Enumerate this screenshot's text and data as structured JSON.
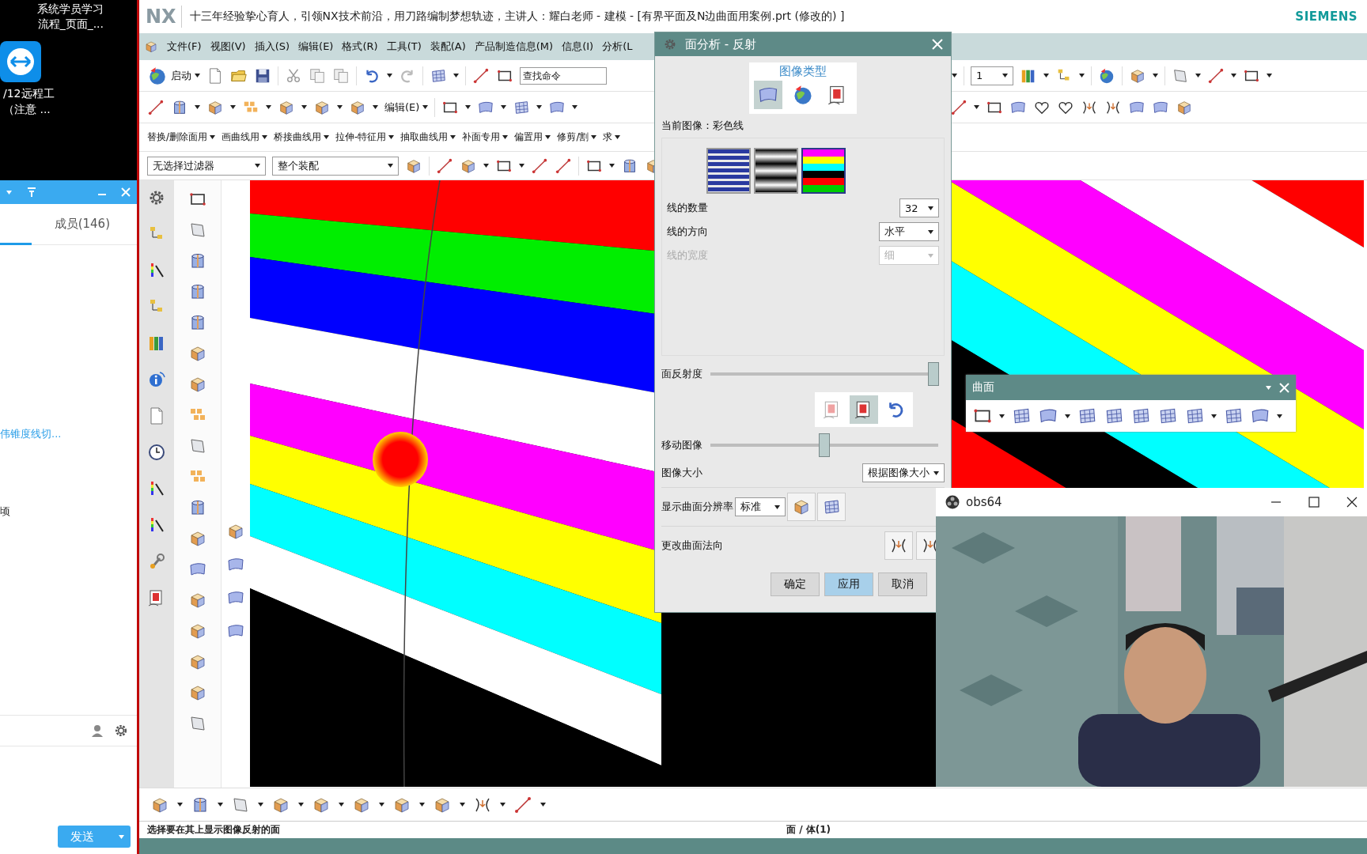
{
  "desktop": {
    "items": [
      {
        "lines": [
          "系统学员学习",
          "流程_页面_..."
        ]
      },
      {
        "lines": [
          "/12远程工",
          "（注意 ..."
        ]
      }
    ]
  },
  "chat": {
    "tab": "成员(146)",
    "link": "伟锥度线切...",
    "text": "顷",
    "send_button": "发送"
  },
  "nx": {
    "logo": "NX",
    "title": "十三年经验挚心育人，引领NX技术前沿，用刀路编制梦想轨迹，主讲人：耀白老师 - 建模 - [有界平面及N边曲面用案例.prt  (修改的) ]",
    "brand": "SIEMENS",
    "menu": [
      "文件(F)",
      "视图(V)",
      "插入(S)",
      "编辑(E)",
      "格式(R)",
      "工具(T)",
      "装配(A)",
      "产品制造信息(M)",
      "信息(I)",
      "分析(L"
    ],
    "start_button": "启动",
    "search": {
      "placeholder": "查找命令"
    },
    "edit_menu": "编辑(E)",
    "command_groups": [
      "替换/删除面用",
      "画曲线用",
      "桥接曲线用",
      "拉伸-特征用",
      "抽取曲线用",
      "补面专用",
      "偏置用",
      "修剪/割",
      "求"
    ],
    "filters": [
      "无选择过滤器",
      "整个装配"
    ],
    "layer_select": "1",
    "status": {
      "prompt": "选择要在其上显示图像反射的面",
      "selection": "面 / 体(1)"
    }
  },
  "dialog": {
    "title": "面分析 - 反射",
    "image_type": {
      "label": "图像类型",
      "options": [
        {
          "kind": "lines",
          "selected": true
        },
        {
          "kind": "scene",
          "selected": false
        },
        {
          "kind": "user",
          "selected": false
        }
      ]
    },
    "current_image": "当前图像：彩色线",
    "line_images": [
      {
        "kind": "blue",
        "selected": false
      },
      {
        "kind": "gray",
        "selected": false
      },
      {
        "kind": "color",
        "selected": true
      }
    ],
    "fields": [
      {
        "label": "线的数量",
        "value": "32",
        "disabled": false
      },
      {
        "label": "线的方向",
        "value": "水平",
        "disabled": false
      },
      {
        "label": "线的宽度",
        "value": "细",
        "disabled": true
      }
    ],
    "reflectivity": {
      "label": "面反射度",
      "level": 0.98
    },
    "move_buttons": [
      {
        "kind": "horizontal",
        "selected": false,
        "disabled": true
      },
      {
        "kind": "vertical",
        "selected": true,
        "disabled": false
      },
      {
        "kind": "rotate",
        "selected": false,
        "disabled": false
      }
    ],
    "move_image": {
      "label": "移动图像",
      "level": 0.5
    },
    "image_size": {
      "label": "图像大小",
      "value": "根据图像大小"
    },
    "resolution": {
      "label": "显示曲面分辨率",
      "value": "标准"
    },
    "normal": {
      "label": "更改曲面法向"
    },
    "buttons": [
      {
        "label": "确定",
        "default": false
      },
      {
        "label": "应用",
        "default": true
      },
      {
        "label": "取消",
        "default": false
      }
    ]
  },
  "surface_toolbar": {
    "title": "曲面"
  },
  "obs": {
    "title": "obs64"
  }
}
